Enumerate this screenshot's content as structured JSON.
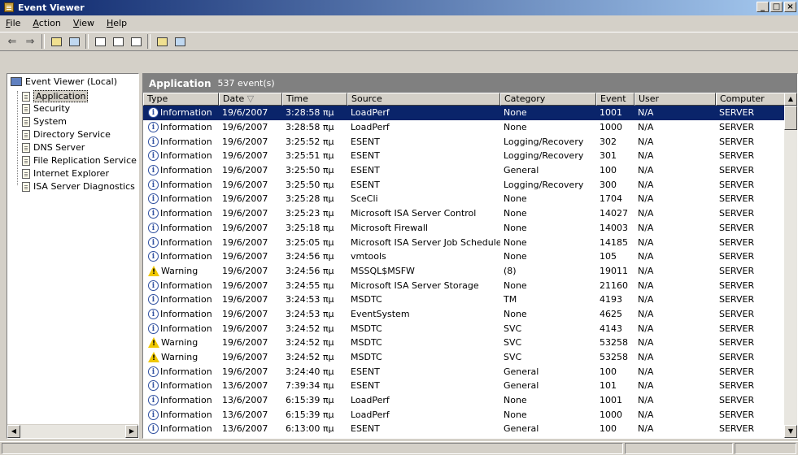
{
  "window": {
    "title": "Event Viewer"
  },
  "menu": [
    {
      "label": "File",
      "key": "F"
    },
    {
      "label": "Action",
      "key": "A"
    },
    {
      "label": "View",
      "key": "V"
    },
    {
      "label": "Help",
      "key": "H"
    }
  ],
  "toolbar": {
    "back": "⇐",
    "forward": "⇒"
  },
  "tree": {
    "root": "Event Viewer (Local)",
    "items": [
      "Application",
      "Security",
      "System",
      "Directory Service",
      "DNS Server",
      "File Replication Service",
      "Internet Explorer",
      "ISA Server Diagnostics"
    ],
    "selected": "Application"
  },
  "pane": {
    "title": "Application",
    "count": "537 event(s)"
  },
  "columns": [
    "Type",
    "Date",
    "Time",
    "Source",
    "Category",
    "Event",
    "User",
    "Computer"
  ],
  "sort_indicator": "▽",
  "rows": [
    {
      "type": "Information",
      "date": "19/6/2007",
      "time": "3:28:58 πμ",
      "source": "LoadPerf",
      "category": "None",
      "event": "1001",
      "user": "N/A",
      "computer": "SERVER"
    },
    {
      "type": "Information",
      "date": "19/6/2007",
      "time": "3:28:58 πμ",
      "source": "LoadPerf",
      "category": "None",
      "event": "1000",
      "user": "N/A",
      "computer": "SERVER"
    },
    {
      "type": "Information",
      "date": "19/6/2007",
      "time": "3:25:52 πμ",
      "source": "ESENT",
      "category": "Logging/Recovery",
      "event": "302",
      "user": "N/A",
      "computer": "SERVER"
    },
    {
      "type": "Information",
      "date": "19/6/2007",
      "time": "3:25:51 πμ",
      "source": "ESENT",
      "category": "Logging/Recovery",
      "event": "301",
      "user": "N/A",
      "computer": "SERVER"
    },
    {
      "type": "Information",
      "date": "19/6/2007",
      "time": "3:25:50 πμ",
      "source": "ESENT",
      "category": "General",
      "event": "100",
      "user": "N/A",
      "computer": "SERVER"
    },
    {
      "type": "Information",
      "date": "19/6/2007",
      "time": "3:25:50 πμ",
      "source": "ESENT",
      "category": "Logging/Recovery",
      "event": "300",
      "user": "N/A",
      "computer": "SERVER"
    },
    {
      "type": "Information",
      "date": "19/6/2007",
      "time": "3:25:28 πμ",
      "source": "SceCli",
      "category": "None",
      "event": "1704",
      "user": "N/A",
      "computer": "SERVER"
    },
    {
      "type": "Information",
      "date": "19/6/2007",
      "time": "3:25:23 πμ",
      "source": "Microsoft ISA Server Control",
      "category": "None",
      "event": "14027",
      "user": "N/A",
      "computer": "SERVER"
    },
    {
      "type": "Information",
      "date": "19/6/2007",
      "time": "3:25:18 πμ",
      "source": "Microsoft Firewall",
      "category": "None",
      "event": "14003",
      "user": "N/A",
      "computer": "SERVER"
    },
    {
      "type": "Information",
      "date": "19/6/2007",
      "time": "3:25:05 πμ",
      "source": "Microsoft ISA Server Job Scheduler",
      "category": "None",
      "event": "14185",
      "user": "N/A",
      "computer": "SERVER"
    },
    {
      "type": "Information",
      "date": "19/6/2007",
      "time": "3:24:56 πμ",
      "source": "vmtools",
      "category": "None",
      "event": "105",
      "user": "N/A",
      "computer": "SERVER"
    },
    {
      "type": "Warning",
      "date": "19/6/2007",
      "time": "3:24:56 πμ",
      "source": "MSSQL$MSFW",
      "category": "(8)",
      "event": "19011",
      "user": "N/A",
      "computer": "SERVER"
    },
    {
      "type": "Information",
      "date": "19/6/2007",
      "time": "3:24:55 πμ",
      "source": "Microsoft ISA Server Storage",
      "category": "None",
      "event": "21160",
      "user": "N/A",
      "computer": "SERVER"
    },
    {
      "type": "Information",
      "date": "19/6/2007",
      "time": "3:24:53 πμ",
      "source": "MSDTC",
      "category": "TM",
      "event": "4193",
      "user": "N/A",
      "computer": "SERVER"
    },
    {
      "type": "Information",
      "date": "19/6/2007",
      "time": "3:24:53 πμ",
      "source": "EventSystem",
      "category": "None",
      "event": "4625",
      "user": "N/A",
      "computer": "SERVER"
    },
    {
      "type": "Information",
      "date": "19/6/2007",
      "time": "3:24:52 πμ",
      "source": "MSDTC",
      "category": "SVC",
      "event": "4143",
      "user": "N/A",
      "computer": "SERVER"
    },
    {
      "type": "Warning",
      "date": "19/6/2007",
      "time": "3:24:52 πμ",
      "source": "MSDTC",
      "category": "SVC",
      "event": "53258",
      "user": "N/A",
      "computer": "SERVER"
    },
    {
      "type": "Warning",
      "date": "19/6/2007",
      "time": "3:24:52 πμ",
      "source": "MSDTC",
      "category": "SVC",
      "event": "53258",
      "user": "N/A",
      "computer": "SERVER"
    },
    {
      "type": "Information",
      "date": "19/6/2007",
      "time": "3:24:40 πμ",
      "source": "ESENT",
      "category": "General",
      "event": "100",
      "user": "N/A",
      "computer": "SERVER"
    },
    {
      "type": "Information",
      "date": "13/6/2007",
      "time": "7:39:34 πμ",
      "source": "ESENT",
      "category": "General",
      "event": "101",
      "user": "N/A",
      "computer": "SERVER"
    },
    {
      "type": "Information",
      "date": "13/6/2007",
      "time": "6:15:39 πμ",
      "source": "LoadPerf",
      "category": "None",
      "event": "1001",
      "user": "N/A",
      "computer": "SERVER"
    },
    {
      "type": "Information",
      "date": "13/6/2007",
      "time": "6:15:39 πμ",
      "source": "LoadPerf",
      "category": "None",
      "event": "1000",
      "user": "N/A",
      "computer": "SERVER"
    },
    {
      "type": "Information",
      "date": "13/6/2007",
      "time": "6:13:00 πμ",
      "source": "ESENT",
      "category": "General",
      "event": "100",
      "user": "N/A",
      "computer": "SERVER"
    }
  ],
  "selected_row": 0,
  "colors": {
    "title_start": "#0a246a",
    "title_end": "#a6caf0",
    "selection": "#0a246a",
    "pane_header": "#808080"
  }
}
